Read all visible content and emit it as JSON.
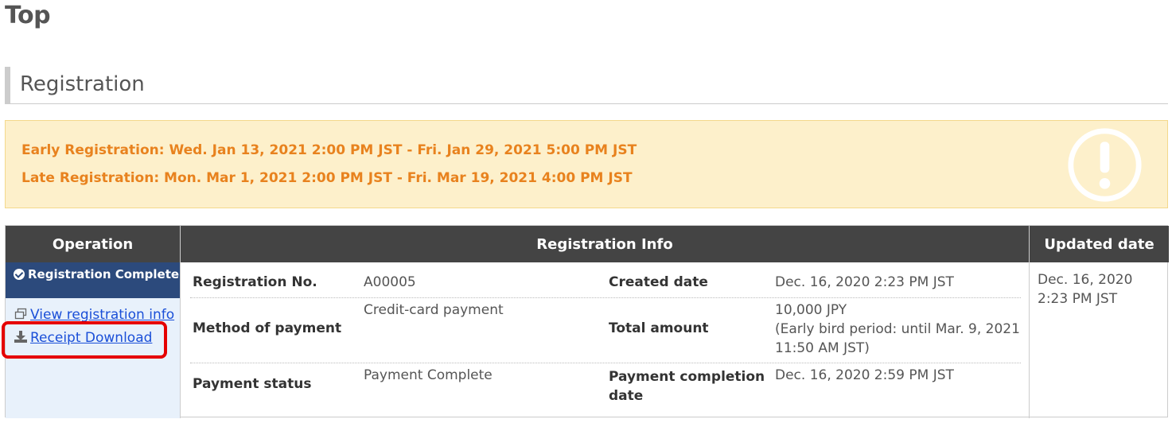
{
  "page": {
    "title": "Top"
  },
  "section": {
    "title": "Registration"
  },
  "notice": {
    "early": "Early Registration: Wed. Jan 13, 2021 2:00 PM JST - Fri. Jan 29, 2021 5:00 PM JST",
    "late": "Late Registration: Mon. Mar 1, 2021 2:00 PM JST - Fri. Mar 19, 2021 4:00 PM JST",
    "icon": "exclamation-circle-icon"
  },
  "table": {
    "headers": {
      "operation": "Operation",
      "info": "Registration Info",
      "updated": "Updated date"
    },
    "operation": {
      "status": "Registration Complete",
      "view_link": "View registration info",
      "receipt_link": "Receipt Download"
    },
    "info": {
      "reg_no_label": "Registration No.",
      "reg_no_value": "A00005",
      "created_label": "Created date",
      "created_value": "Dec. 16, 2020 2:23 PM JST",
      "method_label": "Method of payment",
      "method_value": "Credit-card payment",
      "total_label": "Total amount",
      "total_value_1": "10,000 JPY",
      "total_value_2": "(Early bird period: until Mar. 9, 2021",
      "total_value_3": "11:50 AM JST)",
      "status_label": "Payment status",
      "status_value": "Payment Complete",
      "completion_label_1": "Payment completion",
      "completion_label_2": "date",
      "completion_value": "Dec. 16, 2020 2:59 PM JST"
    },
    "updated": {
      "line1": "Dec. 16, 2020",
      "line2": "2:23 PM JST"
    }
  },
  "colors": {
    "notice_text": "#e8821e",
    "notice_bg": "#fdf0cb",
    "header_bg": "#444444",
    "status_bg": "#2c4a7c",
    "link": "#1a4fd8",
    "highlight": "#e50000"
  }
}
